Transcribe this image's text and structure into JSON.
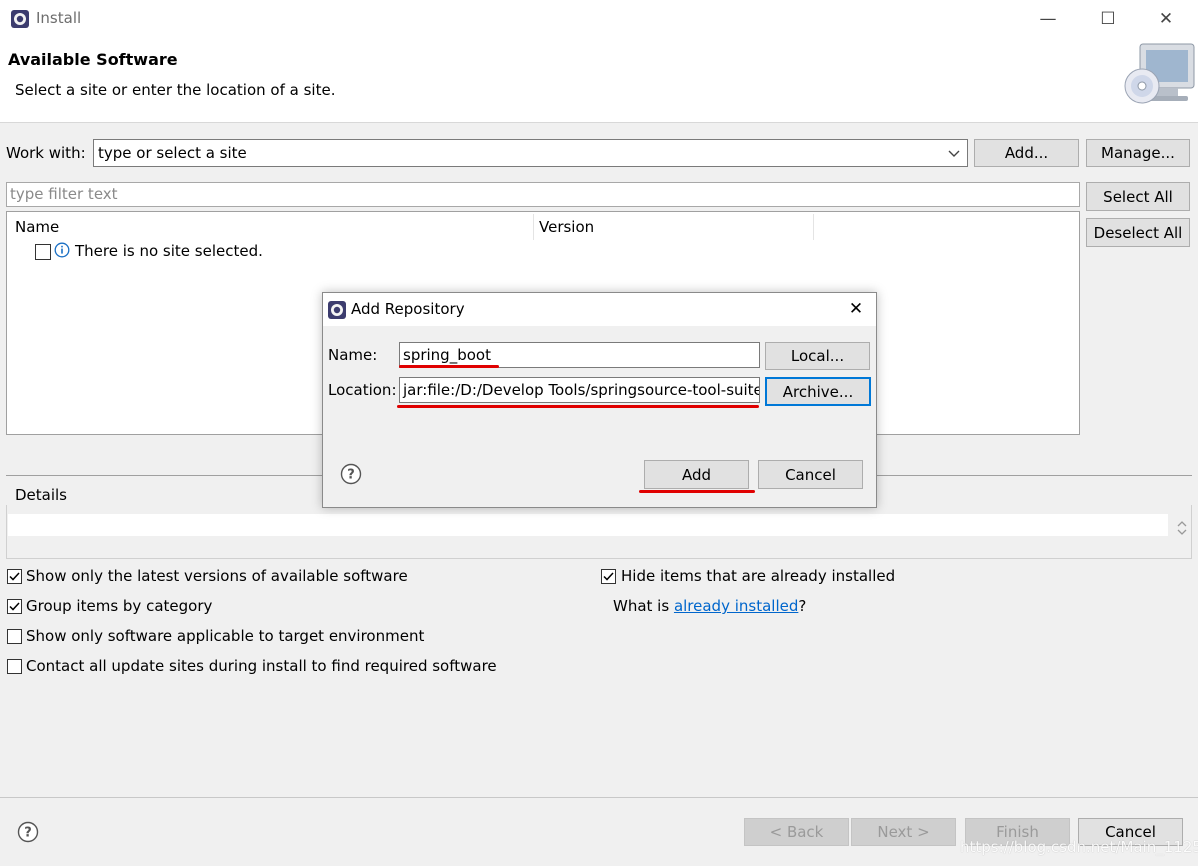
{
  "window": {
    "title": "Install"
  },
  "header": {
    "title": "Available Software",
    "description": "Select a site or enter the location of a site."
  },
  "work_with": {
    "label": "Work with:",
    "placeholder": "type or select a site",
    "add_label": "Add...",
    "manage_label": "Manage..."
  },
  "filter": {
    "placeholder": "type filter text"
  },
  "side_buttons": {
    "select_all": "Select All",
    "deselect_all": "Deselect All"
  },
  "table": {
    "columns": [
      "Name",
      "Version"
    ],
    "rows": [
      {
        "text": "There is no site selected."
      }
    ]
  },
  "details": {
    "label": "Details"
  },
  "options": {
    "left": [
      {
        "label": "Show only the latest versions of available software",
        "checked": true
      },
      {
        "label": "Group items by category",
        "checked": true
      },
      {
        "label": "Show only software applicable to target environment",
        "checked": false
      },
      {
        "label": "Contact all update sites during install to find required software",
        "checked": false
      }
    ],
    "right": [
      {
        "label": "Hide items that are already installed",
        "checked": true
      }
    ],
    "what_is_prefix": "What is ",
    "what_is_link": "already installed",
    "what_is_suffix": "?"
  },
  "footer": {
    "back": "< Back",
    "next": "Next >",
    "finish": "Finish",
    "cancel": "Cancel"
  },
  "dialog": {
    "title": "Add Repository",
    "name_label": "Name:",
    "name_value": "spring_boot",
    "location_label": "Location:",
    "location_value": "jar:file:/D:/Develop Tools/springsource-tool-suite",
    "local_button": "Local...",
    "archive_button": "Archive...",
    "add_button": "Add",
    "cancel_button": "Cancel"
  },
  "watermark": "https://blog.csdn.net/Main_1125",
  "colors": {
    "link": "#0066cc",
    "annotation": "#e00000",
    "focus": "#0078d7"
  }
}
